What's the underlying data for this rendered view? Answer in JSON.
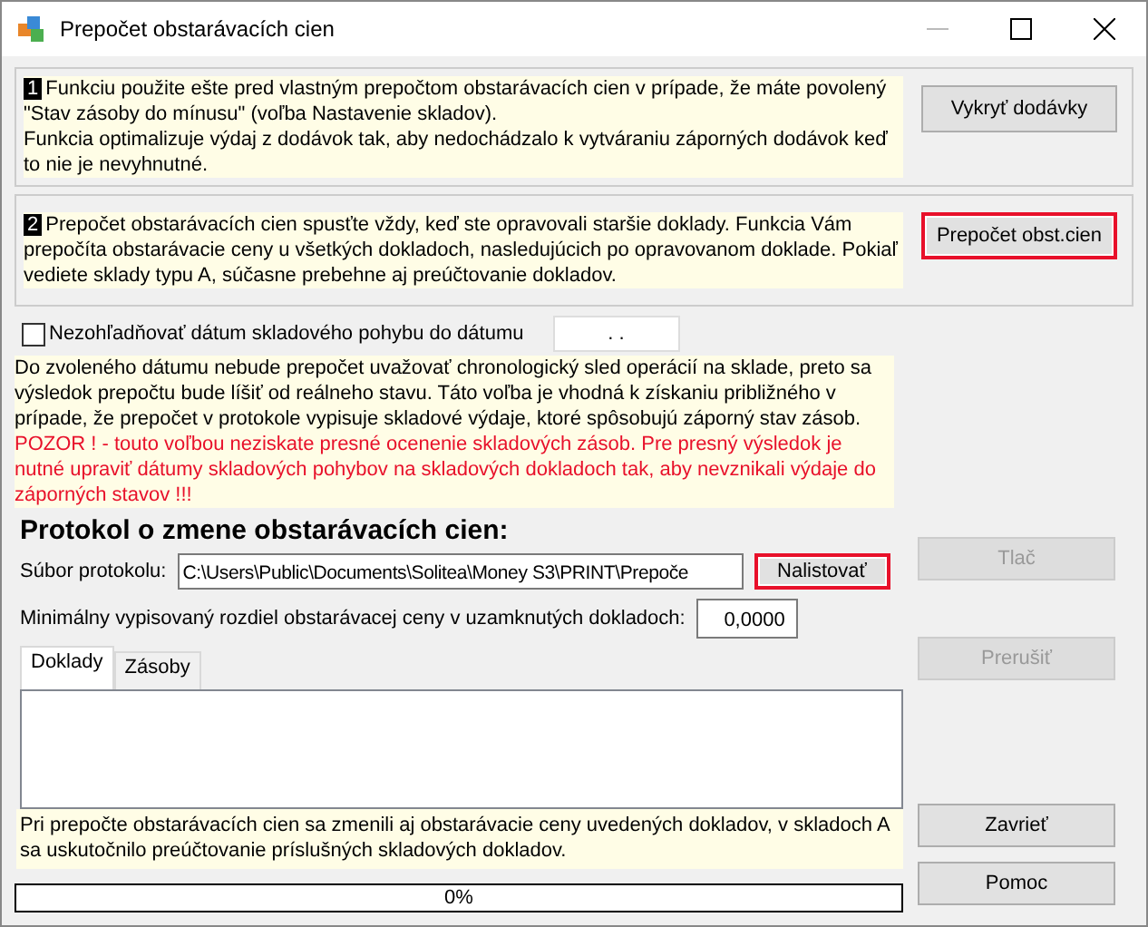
{
  "window": {
    "title": "Prepočet obstarávacích cien"
  },
  "sections": [
    {
      "number": "1",
      "lines": [
        "Funkciu použite ešte pred vlastným prepočtom obstarávacích cien v prípade, že máte povolený \"Stav zásoby do mínusu\" (voľba Nastavenie skladov).",
        "Funkcia optimalizuje výdaj z dodávok tak, aby nedochádzalo k vytváraniu záporných dodávok keď to nie je nevyhnutné."
      ],
      "button": {
        "label": "Vykryť dodávky",
        "highlighted": false
      }
    },
    {
      "number": "2",
      "lines": [
        "Prepočet obstarávacích cien spusťte vždy, keď ste opravovali staršie doklady. Funkcia Vám prepočíta obstarávacie ceny u všetkých dokladoch, nasledujúcich po opravovanom doklade. Pokiaľ vediete sklady typu A, súčasne prebehne aj preúčtovanie dokladov."
      ],
      "button": {
        "label": "Prepočet obst.cien",
        "highlighted": true
      }
    }
  ],
  "date_option": {
    "label": "Nezohľadňovať dátum skladového pohybu do dátumu",
    "checked": false,
    "date_value": ".   ."
  },
  "date_note": {
    "text": "Do zvoleného dátumu nebude prepočet uvažovať chronologický sled operácií na sklade, preto sa výsledok prepočtu bude líšiť od reálneho stavu. Táto voľba je vhodná k získaniu približného v prípade, že prepočet v protokole vypisuje skladové výdaje, ktoré spôsobujú záporný stav zásob.",
    "warning": "POZOR ! - touto voľbou neziskate presné ocenenie skladových zásob. Pre presný výsledok je nutné upraviť dátumy skladových pohybov na skladových dokladoch tak, aby nevznikali výdaje do záporných stavov !!!"
  },
  "protocol": {
    "heading": "Protokol o zmene obstarávacích cien:",
    "file_label": "Súbor protokolu:",
    "file_value": "C:\\Users\\Public\\Documents\\Solitea\\Money S3\\PRINT\\Prepoče",
    "browse_button": {
      "label": "Nalistovať",
      "highlighted": true
    },
    "min_label": "Minimálny vypisovaný rozdiel obstarávacej ceny v uzamknutých dokladoch:",
    "min_value": "0,0000"
  },
  "tabs": [
    {
      "label": "Doklady",
      "selected": true
    },
    {
      "label": "Zásoby",
      "selected": false
    }
  ],
  "result_note": "Pri prepočte obstarávacích cien sa zmenili aj obstarávacie ceny uvedených dokladov, v skladoch A sa uskutočnilo preúčtovanie príslušných skladových dokladov.",
  "progress": {
    "level": 0,
    "reading": "0%"
  },
  "side_buttons": [
    {
      "label": "Tlač",
      "disabled": true
    },
    {
      "label": "Prerušiť",
      "disabled": true
    },
    {
      "label": "Zavrieť",
      "disabled": false
    },
    {
      "label": "Pomoc",
      "disabled": false
    }
  ]
}
